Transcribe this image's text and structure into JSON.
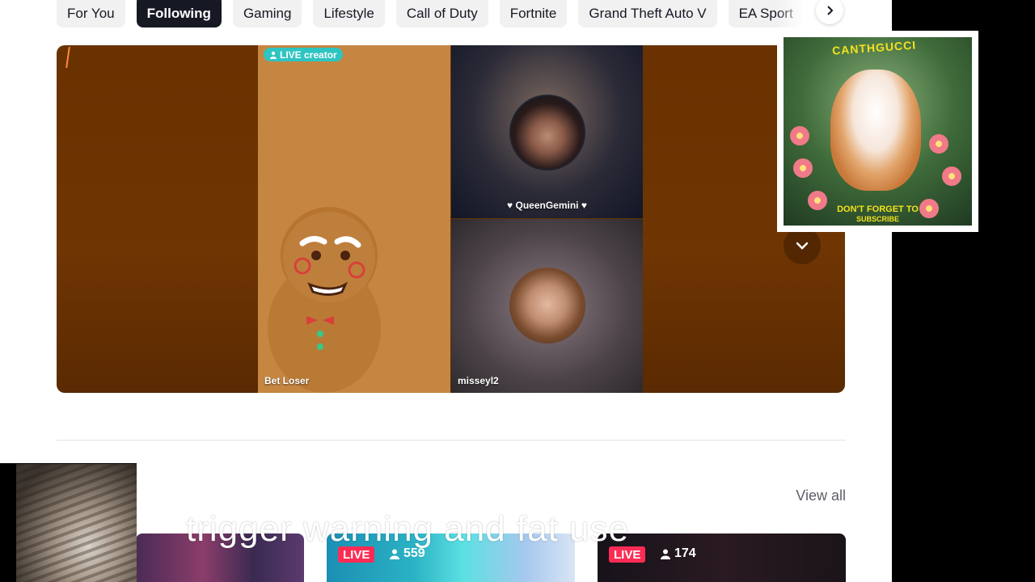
{
  "categories": {
    "items": [
      "For You",
      "Following",
      "Gaming",
      "Lifestyle",
      "Call of Duty",
      "Fortnite",
      "Grand Theft Auto V",
      "EA Sport"
    ],
    "active": "Following",
    "next_icon": "chevron-right-icon"
  },
  "hero": {
    "badge_label": "LIVE creator",
    "tiles": [
      {
        "name": "Bet Loser"
      },
      {
        "name": "QueenGemini"
      },
      {
        "name": "misseyl2"
      }
    ],
    "expand_icon": "chevron-down-icon"
  },
  "overlay_card": {
    "brand": "CANTHGUCCI",
    "cta_line1": "DON'T FORGET TO",
    "cta_line2": "SUBSCRIBE"
  },
  "section": {
    "view_all_label": "View all"
  },
  "thumbnails": [
    {
      "live_label": "",
      "viewers": ""
    },
    {
      "live_label": "LIVE",
      "viewers": "559"
    },
    {
      "live_label": "LIVE",
      "viewers": "174"
    }
  ],
  "caption": "trigger warning and fat use",
  "colors": {
    "accent_live": "#fe2c55",
    "badge_teal": "#2ec4c1",
    "chip_active_bg": "#161823"
  }
}
